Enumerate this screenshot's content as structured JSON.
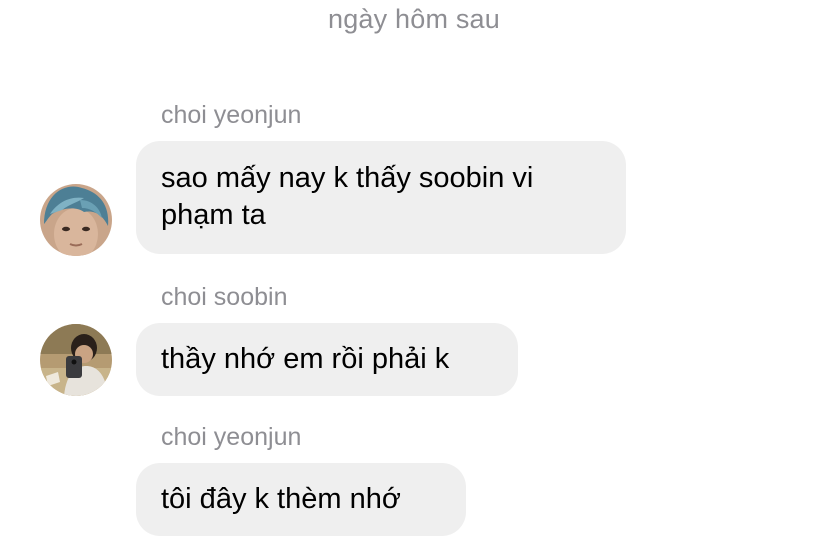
{
  "date_separator": "ngày hôm sau",
  "messages": [
    {
      "sender": "choi yeonjun",
      "text": "sao mấy nay k thấy soobin vi phạm ta",
      "avatar_icon": "profile-photo-blue-hair"
    },
    {
      "sender": "choi soobin",
      "text": "thầy nhớ em rồi phải k",
      "avatar_icon": "profile-photo-mirror-selfie"
    },
    {
      "sender": "choi yeonjun",
      "text": "tôi đây k thèm nhớ"
    }
  ],
  "colors": {
    "background": "#ffffff",
    "bubble": "#efefef",
    "meta_text": "#8e8e93",
    "message_text": "#000000"
  }
}
